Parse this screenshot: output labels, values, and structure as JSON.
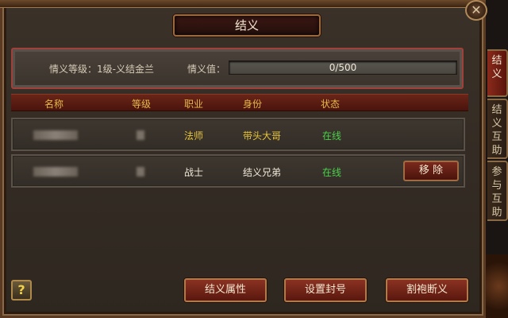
{
  "window": {
    "title": "结义",
    "close_icon": "close-icon"
  },
  "info": {
    "level_label": "情义等级：1级-义结金兰",
    "value_label": "情义值：",
    "progress_text": "0/500",
    "progress_fraction": 0
  },
  "table": {
    "headers": {
      "name": "名称",
      "level": "等级",
      "job": "职业",
      "identity": "身份",
      "status": "状态"
    },
    "rows": [
      {
        "job": "法师",
        "identity": "带头大哥",
        "status": "在线"
      },
      {
        "job": "战士",
        "identity": "结义兄弟",
        "status": "在线",
        "action": "移 除"
      }
    ]
  },
  "buttons": {
    "help": "?",
    "attributes": "结义属性",
    "set_title": "设置封号",
    "sever": "割袍断义"
  },
  "side_tabs": [
    {
      "label": "结义",
      "active": true
    },
    {
      "label": "结义互助",
      "active": false
    },
    {
      "label": "参与互助",
      "active": false
    }
  ],
  "colors": {
    "header_text": "#e6b84a",
    "leader_text": "#e6c43a",
    "online_text": "#4ad24a",
    "normal_text": "#f0e8d8",
    "tab_active": "#8a2a1c"
  }
}
